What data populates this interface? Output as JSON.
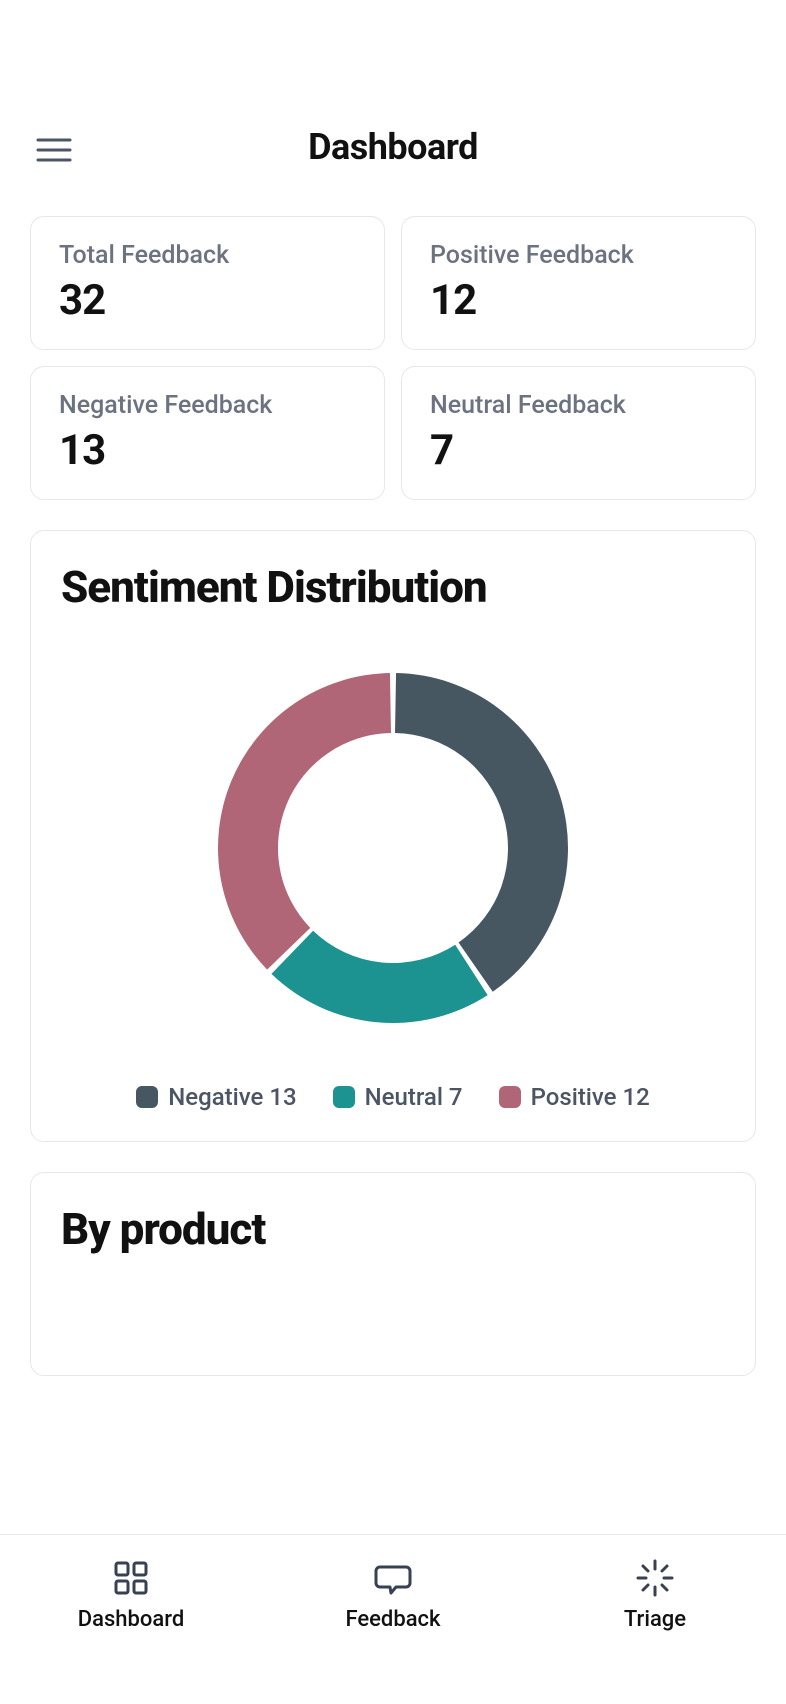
{
  "header": {
    "title": "Dashboard"
  },
  "stats": [
    {
      "label": "Total Feedback",
      "value": "32"
    },
    {
      "label": "Positive Feedback",
      "value": "12"
    },
    {
      "label": "Negative Feedback",
      "value": "13"
    },
    {
      "label": "Neutral Feedback",
      "value": "7"
    }
  ],
  "sentiment_panel": {
    "title": "Sentiment Distribution",
    "legend": [
      {
        "label": "Negative",
        "value": "13",
        "color": "#475762"
      },
      {
        "label": "Neutral",
        "value": "7",
        "color": "#1c9291"
      },
      {
        "label": "Positive",
        "value": "12",
        "color": "#b16677"
      }
    ]
  },
  "by_product_panel": {
    "title": "By product"
  },
  "tabs": [
    {
      "label": "Dashboard"
    },
    {
      "label": "Feedback"
    },
    {
      "label": "Triage"
    }
  ],
  "chart_data": {
    "type": "pie",
    "title": "Sentiment Distribution",
    "series": [
      {
        "name": "Negative",
        "value": 13,
        "color": "#475762"
      },
      {
        "name": "Neutral",
        "value": 7,
        "color": "#1c9291"
      },
      {
        "name": "Positive",
        "value": 12,
        "color": "#b16677"
      }
    ],
    "donut": true
  }
}
